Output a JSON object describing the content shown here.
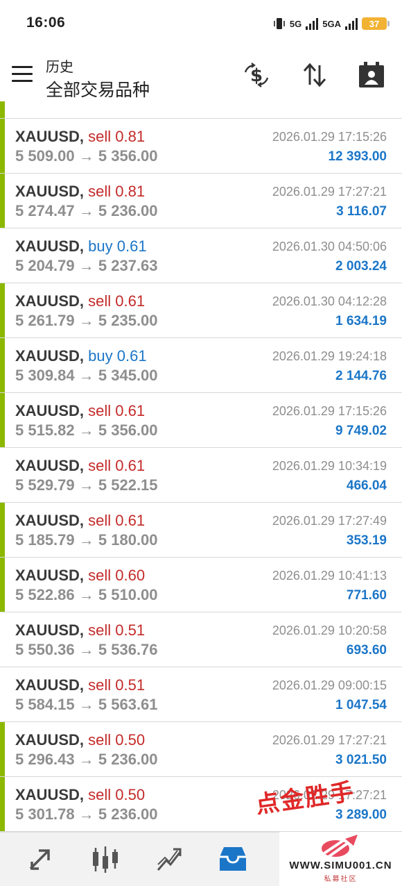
{
  "status_bar": {
    "time": "16:06",
    "network_1": "5G",
    "network_2": "5GA",
    "battery": "37"
  },
  "header": {
    "subtitle": "历史",
    "title": "全部交易品种",
    "icons": [
      "menu-icon",
      "currency-exchange-icon",
      "sort-icon",
      "calendar-icon"
    ]
  },
  "trades": [
    {
      "symbol": "XAUUSD",
      "side": "sell",
      "volume": "0.81",
      "open_price": "5 509.00",
      "close_price": "5 356.00",
      "time": "2026.01.29 17:15:26",
      "profit": "12 393.00"
    },
    {
      "symbol": "XAUUSD",
      "side": "sell",
      "volume": "0.81",
      "open_price": "5 274.47",
      "close_price": "5 236.00",
      "time": "2026.01.29 17:27:21",
      "profit": "3 116.07"
    },
    {
      "symbol": "XAUUSD",
      "side": "buy",
      "volume": "0.61",
      "open_price": "5 204.79",
      "close_price": "5 237.63",
      "time": "2026.01.30 04:50:06",
      "profit": "2 003.24"
    },
    {
      "symbol": "XAUUSD",
      "side": "sell",
      "volume": "0.61",
      "open_price": "5 261.79",
      "close_price": "5 235.00",
      "time": "2026.01.30 04:12:28",
      "profit": "1 634.19"
    },
    {
      "symbol": "XAUUSD",
      "side": "buy",
      "volume": "0.61",
      "open_price": "5 309.84",
      "close_price": "5 345.00",
      "time": "2026.01.29 19:24:18",
      "profit": "2 144.76"
    },
    {
      "symbol": "XAUUSD",
      "side": "sell",
      "volume": "0.61",
      "open_price": "5 515.82",
      "close_price": "5 356.00",
      "time": "2026.01.29 17:15:26",
      "profit": "9 749.02"
    },
    {
      "symbol": "XAUUSD",
      "side": "sell",
      "volume": "0.61",
      "open_price": "5 529.79",
      "close_price": "5 522.15",
      "time": "2026.01.29 10:34:19",
      "profit": "466.04"
    },
    {
      "symbol": "XAUUSD",
      "side": "sell",
      "volume": "0.61",
      "open_price": "5 185.79",
      "close_price": "5 180.00",
      "time": "2026.01.29 17:27:49",
      "profit": "353.19"
    },
    {
      "symbol": "XAUUSD",
      "side": "sell",
      "volume": "0.60",
      "open_price": "5 522.86",
      "close_price": "5 510.00",
      "time": "2026.01.29 10:41:13",
      "profit": "771.60"
    },
    {
      "symbol": "XAUUSD",
      "side": "sell",
      "volume": "0.51",
      "open_price": "5 550.36",
      "close_price": "5 536.76",
      "time": "2026.01.29 10:20:58",
      "profit": "693.60"
    },
    {
      "symbol": "XAUUSD",
      "side": "sell",
      "volume": "0.51",
      "open_price": "5 584.15",
      "close_price": "5 563.61",
      "time": "2026.01.29 09:00:15",
      "profit": "1 047.54"
    },
    {
      "symbol": "XAUUSD",
      "side": "sell",
      "volume": "0.50",
      "open_price": "5 296.43",
      "close_price": "5 236.00",
      "time": "2026.01.29 17:27:21",
      "profit": "3 021.50"
    },
    {
      "symbol": "XAUUSD",
      "side": "sell",
      "volume": "0.50",
      "open_price": "5 301.78",
      "close_price": "5 236.00",
      "time": "2026.01.29 17:27:21",
      "profit": "3 289.00"
    }
  ],
  "row_bar_flags": [
    true,
    true,
    false,
    true,
    true,
    true,
    false,
    true,
    true,
    false,
    false,
    true,
    true
  ],
  "colors": {
    "sell": "#c42a2a",
    "buy": "#1b76c8",
    "profit": "#1b76c8",
    "bar": "#8cb800",
    "tab_active": "#1b76c8"
  },
  "bottom_nav": {
    "items": [
      "trade-icon",
      "chart-icon",
      "trend-icon",
      "history-icon"
    ],
    "active": "history-icon"
  },
  "watermark": {
    "stamp": "点金胜手",
    "url": "WWW.SIMU001.CN",
    "sub": "私募社区"
  }
}
